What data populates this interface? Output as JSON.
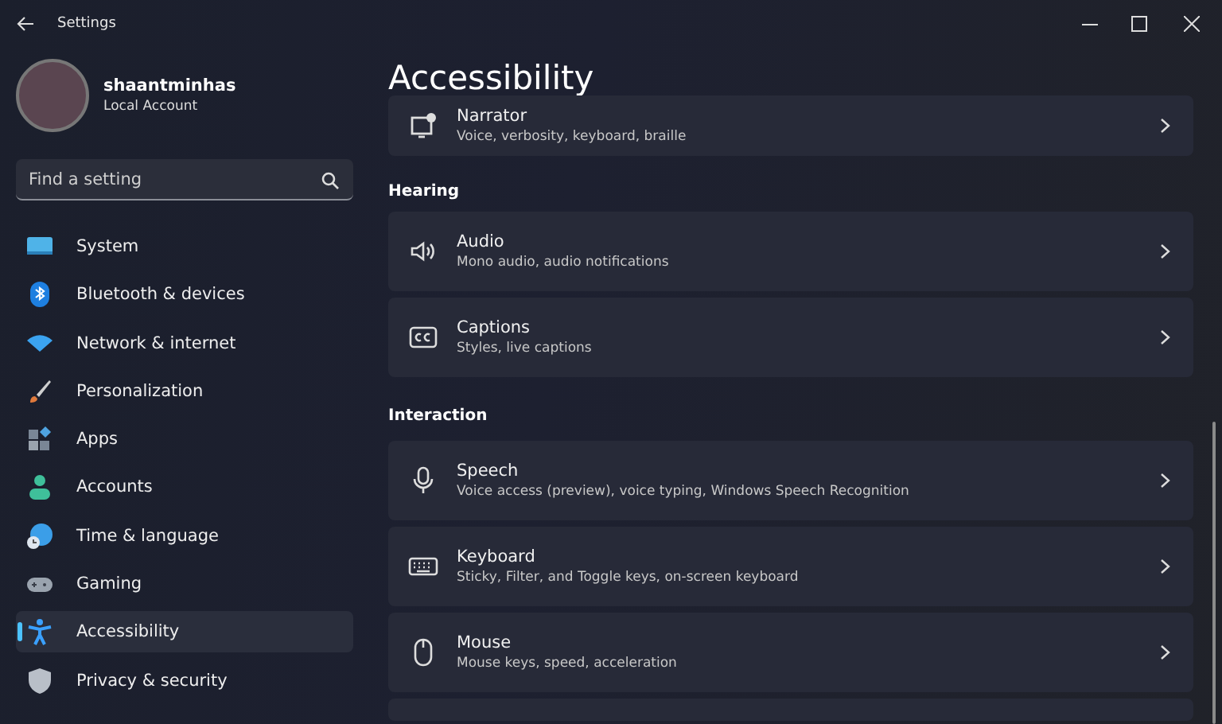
{
  "window": {
    "title": "Settings"
  },
  "account": {
    "name": "shaantminhas",
    "type": "Local Account"
  },
  "search": {
    "placeholder": "Find a setting"
  },
  "nav": [
    {
      "label": "System",
      "selected": false
    },
    {
      "label": "Bluetooth & devices",
      "selected": false
    },
    {
      "label": "Network & internet",
      "selected": false
    },
    {
      "label": "Personalization",
      "selected": false
    },
    {
      "label": "Apps",
      "selected": false
    },
    {
      "label": "Accounts",
      "selected": false
    },
    {
      "label": "Time & language",
      "selected": false
    },
    {
      "label": "Gaming",
      "selected": false
    },
    {
      "label": "Accessibility",
      "selected": true
    },
    {
      "label": "Privacy & security",
      "selected": false
    }
  ],
  "page_title": "Accessibility",
  "sections": [
    {
      "items": [
        {
          "title": "Narrator",
          "subtitle": "Voice, verbosity, keyboard, braille"
        }
      ]
    },
    {
      "heading": "Hearing",
      "items": [
        {
          "title": "Audio",
          "subtitle": "Mono audio, audio notifications"
        },
        {
          "title": "Captions",
          "subtitle": "Styles, live captions"
        }
      ]
    },
    {
      "heading": "Interaction",
      "items": [
        {
          "title": "Speech",
          "subtitle": "Voice access (preview), voice typing, Windows Speech Recognition"
        },
        {
          "title": "Keyboard",
          "subtitle": "Sticky, Filter, and Toggle keys, on-screen keyboard"
        },
        {
          "title": "Mouse",
          "subtitle": "Mouse keys, speed, acceleration"
        }
      ]
    }
  ]
}
